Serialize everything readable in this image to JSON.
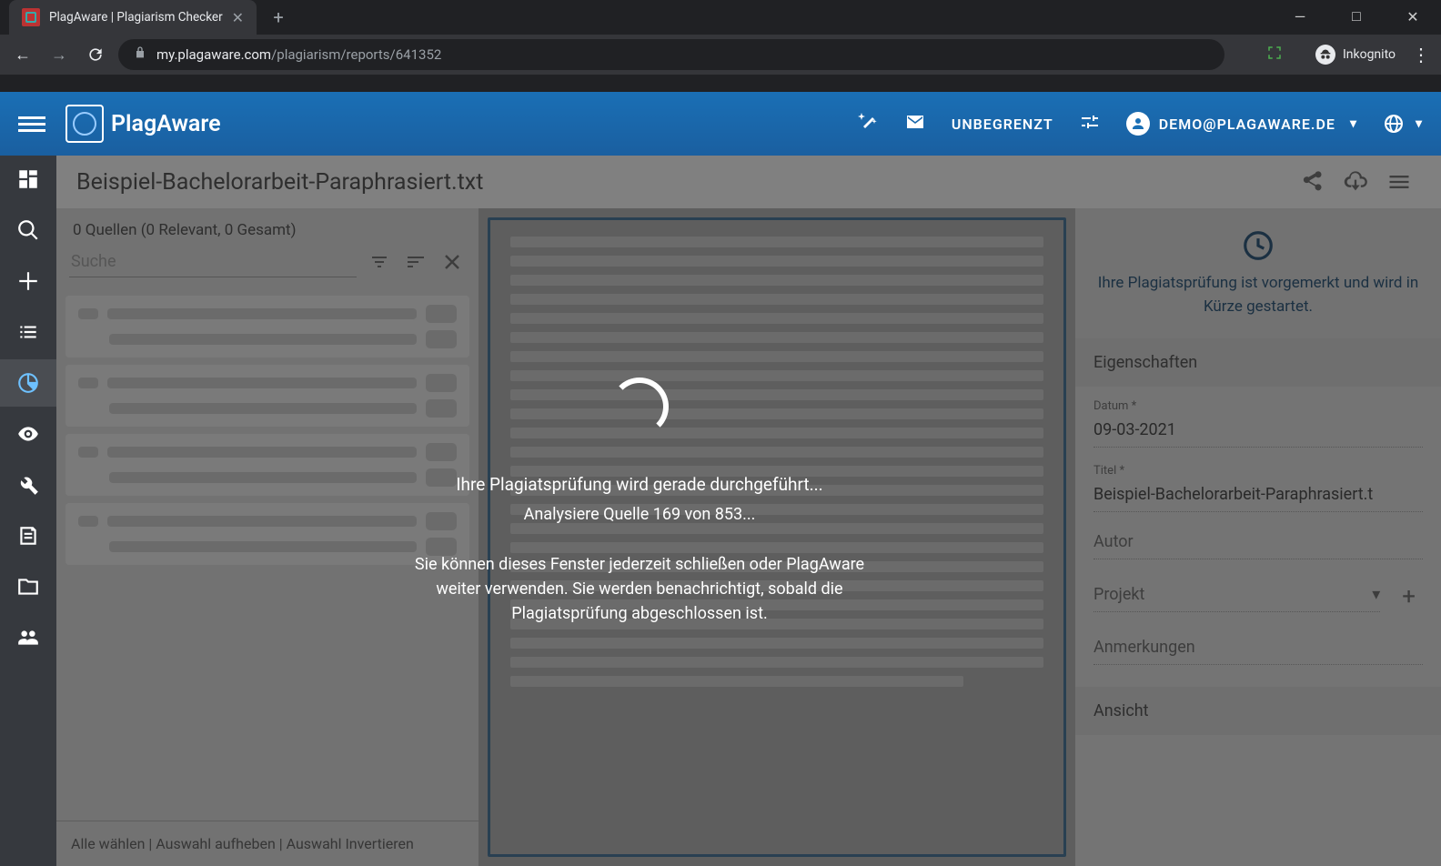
{
  "browser": {
    "tab_title": "PlagAware | Plagiarism Checker",
    "url_domain": "my.plagaware.com",
    "url_path": "/plagiarism/reports/641352",
    "incognito_label": "Inkognito"
  },
  "header": {
    "brand": "PlagAware",
    "quota": "UNBEGRENZT",
    "user": "DEMO@PLAGAWARE.DE"
  },
  "file": {
    "title": "Beispiel-Bachelorarbeit-Paraphrasiert.txt"
  },
  "sources": {
    "summary": "0 Quellen (0 Relevant, 0 Gesamt)",
    "search_placeholder": "Suche",
    "footer": "Alle wählen | Auswahl aufheben | Auswahl Invertieren"
  },
  "status": {
    "message": "Ihre Plagiatsprüfung ist vorgemerkt und wird in Kürze gestartet."
  },
  "properties": {
    "heading": "Eigenschaften",
    "date_label": "Datum *",
    "date_value": "09-03-2021",
    "title_label": "Titel *",
    "title_value": "Beispiel-Bachelorarbeit-Paraphrasiert.t",
    "author_label": "Autor",
    "author_value": "",
    "project_label": "Projekt",
    "notes_label": "Anmerkungen",
    "notes_value": "",
    "view_heading": "Ansicht"
  },
  "overlay": {
    "line1": "Ihre Plagiatsprüfung wird gerade durchgeführt...",
    "line2": "Analysiere Quelle 169 von 853...",
    "note": "Sie können dieses Fenster jederzeit schließen oder PlagAware weiter verwenden. Sie werden benachrichtigt, sobald die Plagiatsprüfung abgeschlossen ist."
  }
}
